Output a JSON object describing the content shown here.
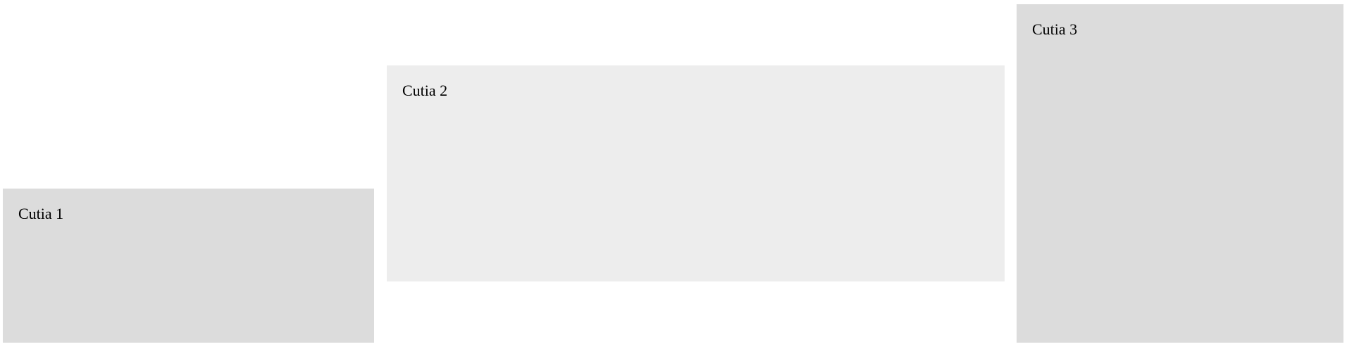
{
  "boxes": [
    {
      "label": "Cutia 1",
      "background": "#dcdcdc"
    },
    {
      "label": "Cutia 2",
      "background": "#ededed"
    },
    {
      "label": "Cutia 3",
      "background": "#dcdcdc"
    }
  ]
}
